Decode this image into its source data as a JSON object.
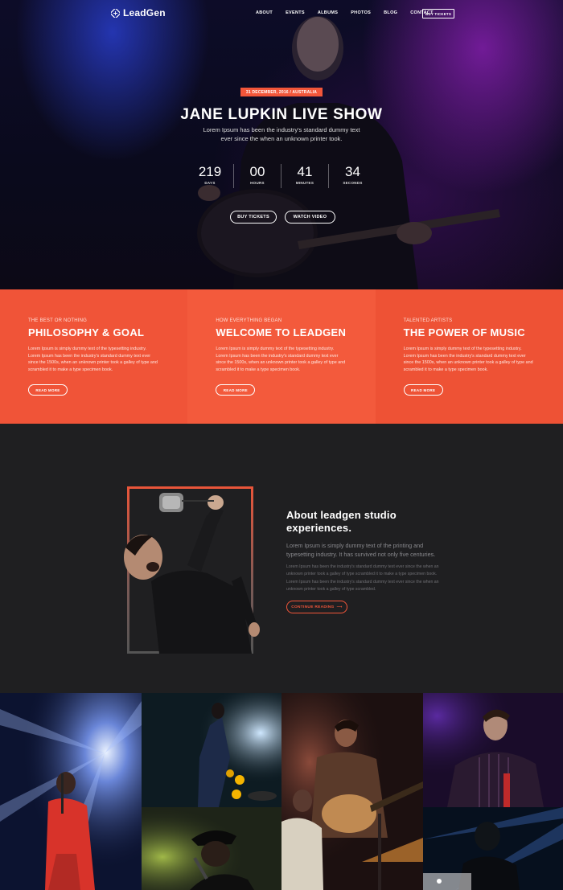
{
  "nav": {
    "logo_text": "LeadGen",
    "links": [
      "ABOUT",
      "EVENTS",
      "ALBUMS",
      "PHOTOS",
      "BLOG",
      "CONTACT"
    ],
    "cta": "BUY TICKETS"
  },
  "hero": {
    "badge": "31 DECEMBER, 2016 / AUSTRALIA",
    "title": "JANE LUPKIN LIVE SHOW",
    "subtitle": "Lorem Ipsum has been the industry's standard dummy text ever since the when an unknown printer took.",
    "countdown": [
      {
        "value": "219",
        "label": "DAYS"
      },
      {
        "value": "00",
        "label": "HOURS"
      },
      {
        "value": "41",
        "label": "MINUTES"
      },
      {
        "value": "34",
        "label": "SECONDS"
      }
    ],
    "buttons": [
      "BUY TICKETS",
      "WATCH VIDEO"
    ]
  },
  "features": [
    {
      "kicker": "THE BEST OR NOTHING",
      "title": "PHILOSOPHY & GOAL",
      "text": "Lorem Ipsum is simply dummy text of the typesetting industry. Lorem Ipsum has been the industry's standard dummy text ever since the 1500s, when an unknown printer took a galley of type and scrambled it to make a type specimen book.",
      "button": "READ MORE"
    },
    {
      "kicker": "HOW EVERYTHING BEGAN",
      "title": "WELCOME TO LEADGEN",
      "text": "Lorem Ipsum is simply dummy text of the typesetting industry. Lorem Ipsum has been the industry's standard dummy text ever since the 1500s, when an unknown printer took a galley of type and scrambled it to make a type specimen book.",
      "button": "READ MORE"
    },
    {
      "kicker": "TALENTED ARTISTS",
      "title": "THE POWER OF MUSIC",
      "text": "Lorem Ipsum is simply dummy text of the typesetting industry. Lorem Ipsum has been the industry's standard dummy text ever since the 1500s, when an unknown printer took a galley of type and scrambled it to make a type specimen book.",
      "button": "READ MORE"
    }
  ],
  "about": {
    "title": "About leadgen studio experiences.",
    "lead": "Lorem Ipsum is simply dummy text of the printing and typesetting industry. It has survived not only five centuries.",
    "body": "Lorem Ipsum has been the industry's standard dummy text ever since the when an unknown printer took a galley of type scrambled it to make a type specimen book. Lorem Ipsum has been the industry's standard dummy text ever since the when an unknown printer took a galley of type scrambled.",
    "button": "CONTINUE READING",
    "button_icon": "arrow-right-icon"
  },
  "colors": {
    "accent": "#f3563a",
    "dark_bg": "#1f1f21"
  }
}
